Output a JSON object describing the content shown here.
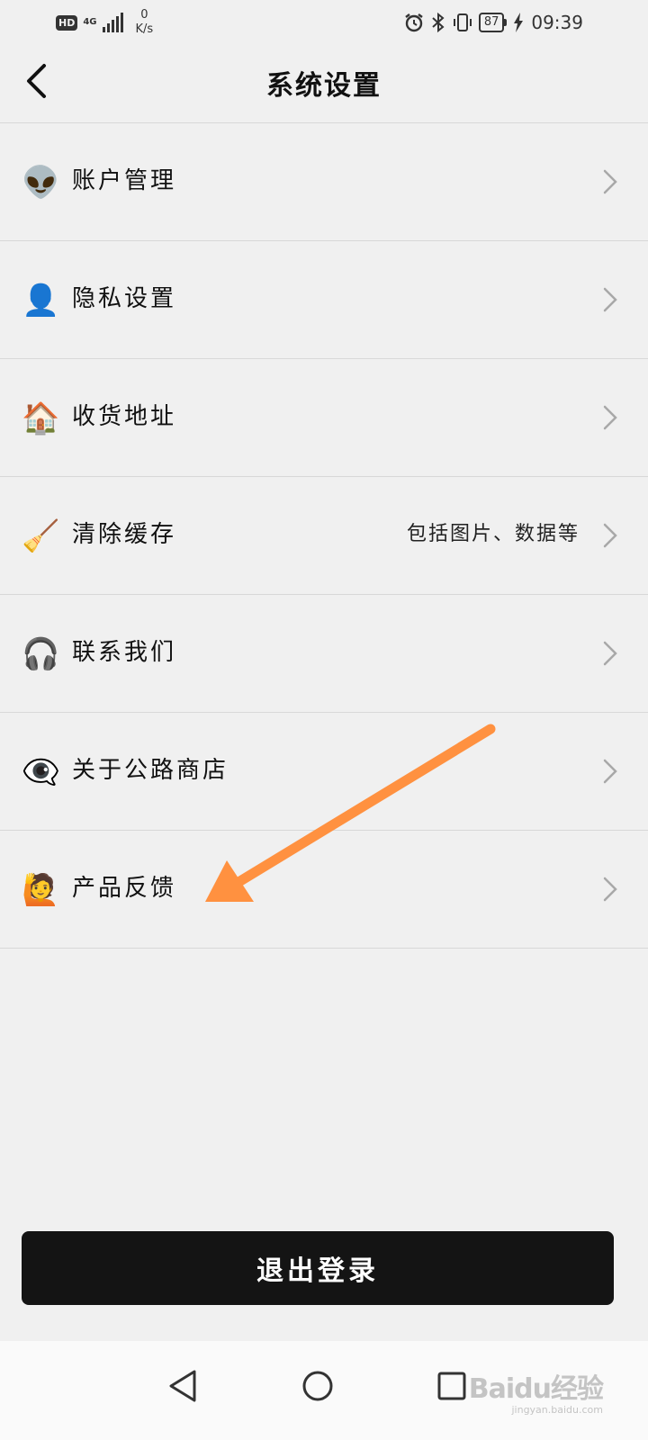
{
  "status_bar": {
    "hd": "HD",
    "network": "4G",
    "speed_value": "0",
    "speed_unit": "K/s",
    "battery": "87",
    "time": "09:39"
  },
  "header": {
    "title": "系统设置"
  },
  "menu": [
    {
      "icon": "👽",
      "icon_name": "alien-icon",
      "label": "账户管理",
      "sub": ""
    },
    {
      "icon": "👤",
      "icon_name": "person-silhouette-icon",
      "label": "隐私设置",
      "sub": ""
    },
    {
      "icon": "🏠",
      "icon_name": "house-icon",
      "label": "收货地址",
      "sub": ""
    },
    {
      "icon": "🧹",
      "icon_name": "broom-icon",
      "label": "清除缓存",
      "sub": "包括图片、数据等"
    },
    {
      "icon": "🎧",
      "icon_name": "headphones-icon",
      "label": "联系我们",
      "sub": ""
    },
    {
      "icon": "👁️‍🗨️",
      "icon_name": "eye-in-speech-bubble-icon",
      "label": "关于公路商店",
      "sub": ""
    },
    {
      "icon": "🙋",
      "icon_name": "person-raising-hand-icon",
      "label": "产品反馈",
      "sub": ""
    }
  ],
  "logout": {
    "label": "退出登录"
  },
  "watermark": {
    "logo": "Baidu经验",
    "sub": "jingyan.baidu.com"
  },
  "colors": {
    "background": "#f0f0f0",
    "logout_bg": "#141414",
    "annotation_arrow": "#ff9140",
    "divider": "#d8d8d8"
  }
}
